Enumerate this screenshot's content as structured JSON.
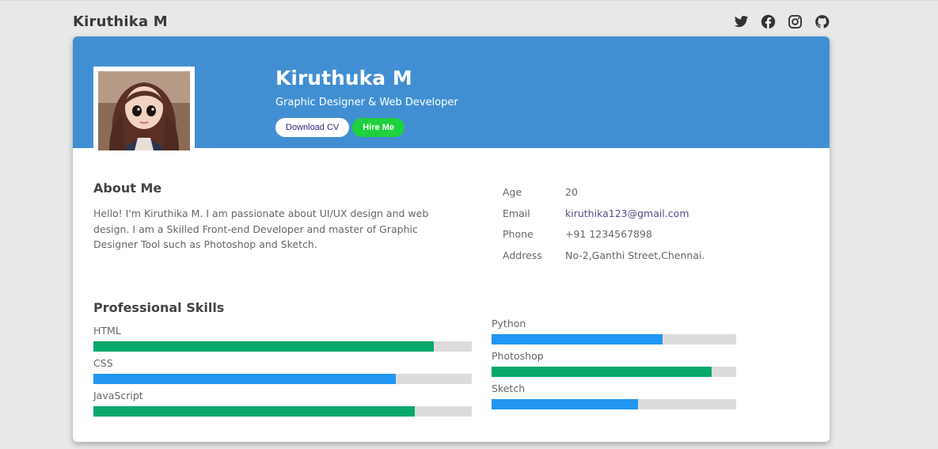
{
  "header": {
    "brand": "Kiruthika M",
    "socials": [
      {
        "icon": "twitter-icon"
      },
      {
        "icon": "facebook-icon"
      },
      {
        "icon": "instagram-icon"
      },
      {
        "icon": "github-icon"
      }
    ]
  },
  "profile": {
    "name": "Kiruthuka M",
    "role": "Graphic Designer & Web Developer",
    "download_label": "Download CV",
    "hire_label": "Hire Me"
  },
  "about": {
    "title": "About Me",
    "text": "Hello! I'm Kiruthika M. I am passionate about UI/UX design and web design. I am a Skilled Front-end Developer and master of Graphic Designer Tool such as Photoshop and Sketch."
  },
  "info": [
    {
      "label": "Age",
      "value": "20"
    },
    {
      "label": "Email",
      "value": "kiruthika123@gmail.com"
    },
    {
      "label": "Phone",
      "value": "+91 1234567898"
    },
    {
      "label": "Address",
      "value": "No-2,Ganthi Street,Chennai."
    }
  ],
  "skills": {
    "title": "Professional Skills",
    "left": [
      {
        "name": "HTML",
        "level": 0.9,
        "color": "#08a86b"
      },
      {
        "name": "CSS",
        "level": 0.8,
        "color": "#2196f3"
      },
      {
        "name": "JavaScript",
        "level": 0.85,
        "color": "#08a86b"
      }
    ],
    "right": [
      {
        "name": "Python",
        "level": 0.7,
        "color": "#2196f3"
      },
      {
        "name": "Photoshop",
        "level": 0.9,
        "color": "#08a86b"
      },
      {
        "name": "Sketch",
        "level": 0.6,
        "color": "#2196f3"
      }
    ]
  },
  "colors": {
    "hero": "#418fd2",
    "hire_button": "#1fd13e",
    "bar_track": "#dcdcdc"
  }
}
